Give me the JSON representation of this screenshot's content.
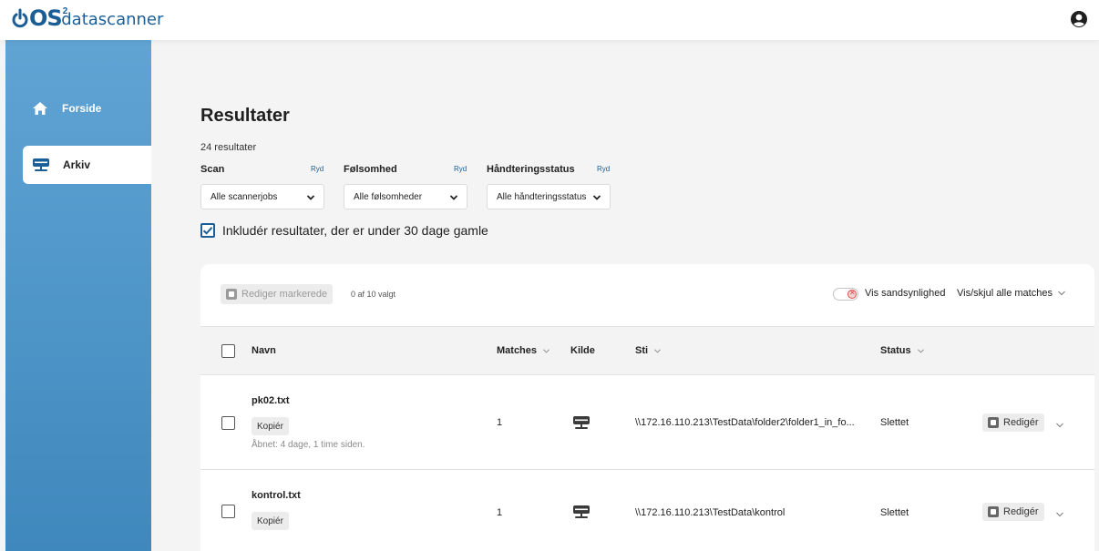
{
  "brand": {
    "logo_os": "OS",
    "logo_sup": "2",
    "logo_text": "datascanner"
  },
  "sidebar": {
    "items": [
      {
        "label": "Forside",
        "icon": "home-icon",
        "active": false
      },
      {
        "label": "Arkiv",
        "icon": "server-icon",
        "active": true
      }
    ]
  },
  "main": {
    "title": "Resultater",
    "result_count": "24 resultater",
    "filters": {
      "scan": {
        "label": "Scan",
        "clear": "Ryd",
        "value": "Alle scannerjobs"
      },
      "sensitivity": {
        "label": "Følsomhed",
        "clear": "Ryd",
        "value": "Alle følsomheder"
      },
      "status": {
        "label": "Håndteringsstatus",
        "clear": "Ryd",
        "value": "Alle håndteringsstatus"
      }
    },
    "include_recent": {
      "label": "Inkludér resultater, der er under 30 dage gamle",
      "checked": true
    }
  },
  "toolbar": {
    "edit_marked": "Rediger markerede",
    "selected_count": "0 af 10 valgt",
    "probability_toggle": "Vis sandsynlighed",
    "toggle_all": "Vis/skjul alle matches"
  },
  "table": {
    "headers": {
      "name": "Navn",
      "matches": "Matches",
      "source": "Kilde",
      "path": "Sti",
      "status": "Status"
    },
    "rows": [
      {
        "name": "pk02.txt",
        "copy": "Kopiér",
        "opened": "Åbnet: 4 dage, 1 time siden.",
        "matches": "1",
        "source_icon": "server-icon",
        "path": "\\\\172.16.110.213\\TestData\\folder2\\folder1_in_fo...",
        "status": "Slettet",
        "edit": "Redigér"
      },
      {
        "name": "kontrol.txt",
        "copy": "Kopiér",
        "matches": "1",
        "source_icon": "server-icon",
        "path": "\\\\172.16.110.213\\TestData\\kontrol",
        "status": "Slettet",
        "edit": "Redigér"
      }
    ]
  },
  "colors": {
    "brand": "#1b5e96",
    "sidebar": "#4f97cb",
    "danger": "#e04b4b"
  }
}
